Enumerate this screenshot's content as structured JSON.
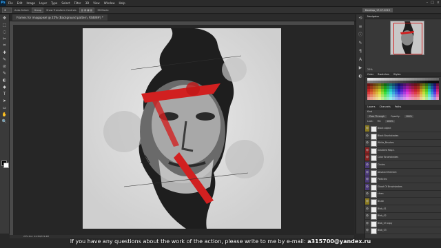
{
  "app": {
    "logo": "Ps"
  },
  "menu": [
    "File",
    "Edit",
    "Image",
    "Layer",
    "Type",
    "Select",
    "Filter",
    "3D",
    "View",
    "Window",
    "Help"
  ],
  "window_controls": [
    "–",
    "□",
    "×"
  ],
  "options_bar": {
    "tool_icon": "move-tool-icon",
    "auto_select_label": "Auto-Select:",
    "auto_select_value": "Group",
    "transform_label": "Show Transform Controls",
    "mode_label": "3D Mode:",
    "workspace": "Desktop_17.07.2019"
  },
  "document_tab": {
    "title": "Frames for imagopixel @ 25% (Background pattern, RGB/8#) *"
  },
  "toolbar": {
    "tools": [
      "✥",
      "⬚",
      "◌",
      "✂",
      "⌗",
      "✚",
      "✎",
      "⊘",
      "✎",
      "◐",
      "◆",
      "T",
      "➤",
      "▭",
      "✋",
      "🔍"
    ]
  },
  "status_bar": {
    "zoom": "25%",
    "doc": "Doc: 24.3M/372.4M"
  },
  "right_panels": {
    "navigator_tab": "Navigator",
    "navigator_zoom": "25%",
    "color_tabs": [
      "Color",
      "Swatches",
      "Styles"
    ],
    "layers_tabs": [
      "Layers",
      "Channels",
      "Paths"
    ],
    "blend_mode": "Pass Through",
    "opacity_label": "Opacity:",
    "opacity_value": "100%",
    "fill_label": "Fill:",
    "fill_value": "100%",
    "lock_label": "Lock:",
    "kind_label": "Kind"
  },
  "layers": [
    {
      "name": "Black object",
      "color": "#8a7a20"
    },
    {
      "name": "Black Brushstrokes",
      "color": "#3e3e3e"
    },
    {
      "name": "White_Brushes",
      "color": "#3e3e3e"
    },
    {
      "name": "Gradient Map 1",
      "color": "#8a2020"
    },
    {
      "name": "Color Brushstrokes",
      "color": "#8a2020"
    },
    {
      "name": "Circles",
      "color": "#4c3a7a"
    },
    {
      "name": "Abstract Element",
      "color": "#4c3a7a"
    },
    {
      "name": "Particles",
      "color": "#4c3a7a"
    },
    {
      "name": "Ghost Of Brushstrokes",
      "color": "#4c3a7a"
    },
    {
      "name": "clean",
      "color": "#3e3e3e"
    },
    {
      "name": "Brush",
      "color": "#8a7a20"
    },
    {
      "name": "Blob_01",
      "color": "#3e3e3e"
    },
    {
      "name": "Blob_02",
      "color": "#3e3e3e"
    },
    {
      "name": "Blob_03 copy",
      "color": "#3e3e3e"
    },
    {
      "name": "Blob_03",
      "color": "#3e3e3e"
    }
  ],
  "subtitle": {
    "text": "If you have any questions about the work of the action, please write to me by e-mail: ",
    "email": "a315700@yandex.ru"
  },
  "colors": {
    "accent_red": "#d12020",
    "canvas_bg": "#d9d9d9"
  }
}
